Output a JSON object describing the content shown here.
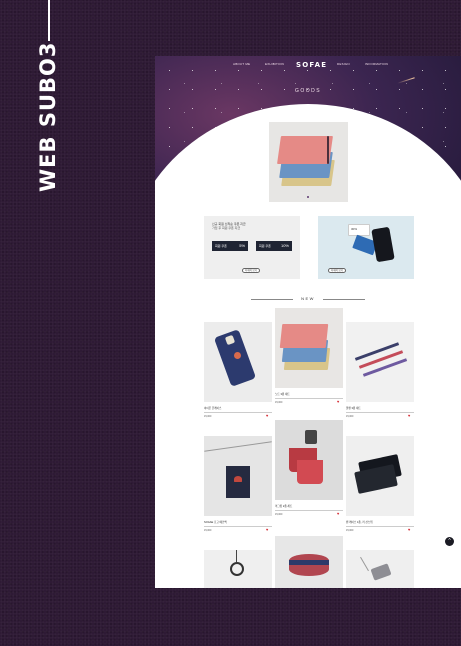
{
  "side_title": "WEB SUBO3",
  "nav": {
    "items": [
      "ABOUT ME",
      "EXHIBITION",
      "DESIGN",
      "INFORMATION"
    ],
    "logo": "SOFAE"
  },
  "hero": {
    "title": "GOODS"
  },
  "banners": {
    "coupon": {
      "line1": "신규 회원 선착순 쿠폰 지급",
      "line2": "가입 후 회원 쿠폰 지급",
      "coupons": [
        {
          "label": "회원 쿠폰",
          "value": "5%"
        },
        {
          "label": "회원 쿠폰",
          "value": "10%"
        }
      ],
      "button": "자세히 보기"
    },
    "event": {
      "card_text": "30%",
      "button": "자세히 보기"
    }
  },
  "new_section": {
    "label": "NEW"
  },
  "products": [
    {
      "name": "아이폰 폰케이스",
      "price": "15,000"
    },
    {
      "name": "노트 3종 세트",
      "price": "15,000"
    },
    {
      "name": "볼펜 3종 세트",
      "price": "15,000"
    },
    {
      "name": "SOGAE 로고 에코백",
      "price": "15,000"
    },
    {
      "name": "머그컵 2종 세트",
      "price": "15,000"
    },
    {
      "name": "펜 케이스 1종, 키 선스위",
      "price": "15,000"
    },
    {
      "name": "",
      "price": ""
    },
    {
      "name": "",
      "price": ""
    },
    {
      "name": "",
      "price": ""
    }
  ],
  "colors": {
    "background": "#2e1a35",
    "hero": "#3b2550",
    "accent_heart": "#d6323a"
  },
  "icons": {
    "heart": "♥",
    "scroll_top": "^"
  }
}
